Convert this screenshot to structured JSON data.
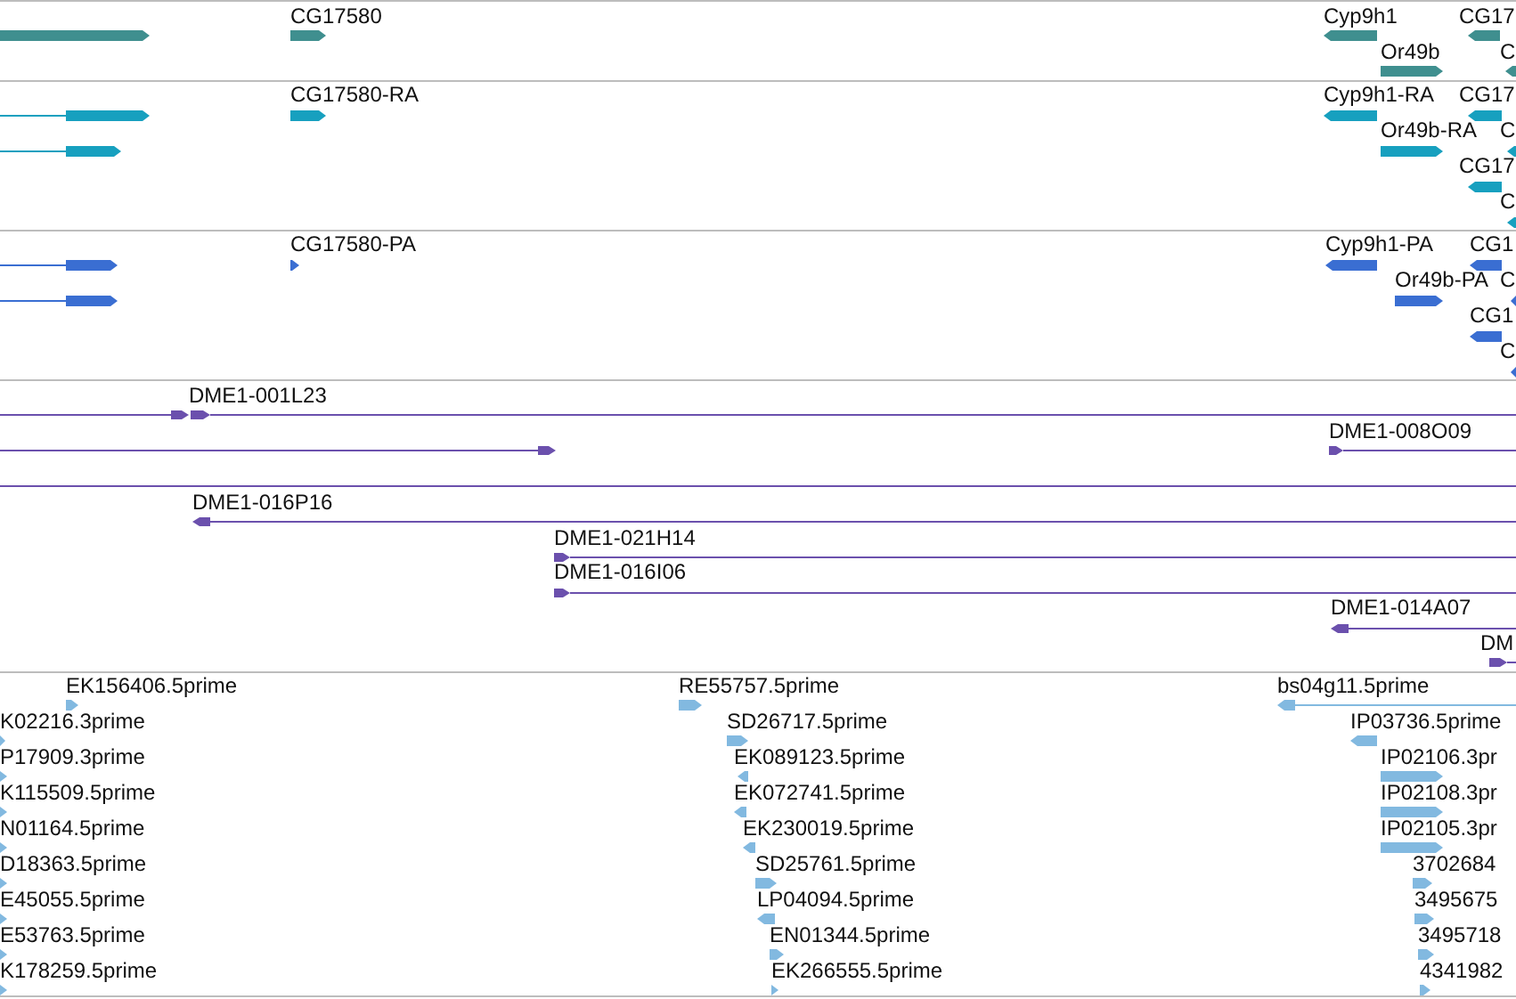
{
  "tracks": [
    {
      "kind": "gene",
      "color": "#3f8f8f",
      "features": [
        {
          "forward": true
        },
        {
          "label": "CG17580",
          "forward": true
        },
        {
          "label": "Cyp9h1",
          "forward": false
        },
        {
          "label": "Or49b",
          "forward": true
        },
        {
          "label": "CG17",
          "forward": false
        },
        {
          "label": "C",
          "forward": false
        }
      ]
    },
    {
      "kind": "transcript",
      "color": "#17a0bf",
      "features": [
        {
          "forward": true
        },
        {
          "forward": true
        },
        {
          "label": "CG17580-RA",
          "forward": true
        },
        {
          "label": "Cyp9h1-RA",
          "forward": false
        },
        {
          "label": "Or49b-RA",
          "forward": true
        },
        {
          "label": "CG17",
          "forward": false
        },
        {
          "label": "C",
          "forward": false
        },
        {
          "label": "CG17",
          "forward": false
        },
        {
          "label": "C",
          "forward": false
        }
      ]
    },
    {
      "kind": "protein",
      "color": "#3a6ed2",
      "features": [
        {
          "forward": true
        },
        {
          "forward": true
        },
        {
          "label": "CG17580-PA",
          "forward": true
        },
        {
          "label": "Cyp9h1-PA",
          "forward": false
        },
        {
          "label": "Or49b-PA",
          "forward": true
        },
        {
          "label": "CG1",
          "forward": false
        },
        {
          "label": "C",
          "forward": false
        },
        {
          "label": "CG1",
          "forward": false
        },
        {
          "label": "C",
          "forward": false
        }
      ]
    },
    {
      "kind": "clone",
      "color": "#6b50ad",
      "features": [
        {
          "kind": "arrow",
          "forward": true
        },
        {
          "kind": "arrow",
          "label": "DME1-001L23",
          "forward": true
        },
        {
          "kind": "arrow",
          "forward": true
        },
        {
          "kind": "arrow",
          "label": "DME1-008O09",
          "forward": true
        },
        {
          "kind": "line"
        },
        {
          "kind": "arrow",
          "label": "DME1-016P16",
          "forward": false
        },
        {
          "kind": "arrow",
          "label": "DME1-021H14",
          "forward": true
        },
        {
          "kind": "arrow",
          "label": "DME1-016I06",
          "forward": true
        },
        {
          "kind": "arrow",
          "label": "DME1-014A07",
          "forward": false
        },
        {
          "kind": "arrow",
          "label": "DM",
          "forward": true
        }
      ]
    },
    {
      "kind": "est",
      "color": "#82b9e0",
      "features": [
        {
          "label": "EK156406.5prime",
          "forward": true
        },
        {
          "label": "K02216.3prime",
          "forward": true
        },
        {
          "label": "P17909.3prime",
          "forward": true
        },
        {
          "label": "K115509.5prime",
          "forward": true
        },
        {
          "label": "N01164.5prime",
          "forward": true
        },
        {
          "label": "D18363.5prime",
          "forward": true
        },
        {
          "label": "E45055.5prime",
          "forward": true
        },
        {
          "label": "E53763.5prime",
          "forward": true
        },
        {
          "label": "K178259.5prime",
          "forward": true
        },
        {
          "label": "RE55757.5prime",
          "forward": true
        },
        {
          "label": "SD26717.5prime",
          "forward": true
        },
        {
          "label": "EK089123.5prime",
          "forward": false
        },
        {
          "label": "EK072741.5prime",
          "forward": false
        },
        {
          "label": "EK230019.5prime",
          "forward": false
        },
        {
          "label": "SD25761.5prime",
          "forward": true
        },
        {
          "label": "LP04094.5prime",
          "forward": false
        },
        {
          "label": "EN01344.5prime",
          "forward": true
        },
        {
          "label": "EK266555.5prime",
          "forward": true
        },
        {
          "label": "bs04g11.5prime",
          "forward": false
        },
        {
          "label": "IP03736.5prime",
          "forward": false
        },
        {
          "label": "IP02106.3pr",
          "forward": true
        },
        {
          "label": "IP02108.3pr",
          "forward": true
        },
        {
          "label": "IP02105.3pr",
          "forward": true
        },
        {
          "label": "3702684",
          "forward": true
        },
        {
          "label": "3495675",
          "forward": true
        },
        {
          "label": "3495718",
          "forward": true
        },
        {
          "label": "4341982",
          "forward": true
        }
      ]
    }
  ]
}
